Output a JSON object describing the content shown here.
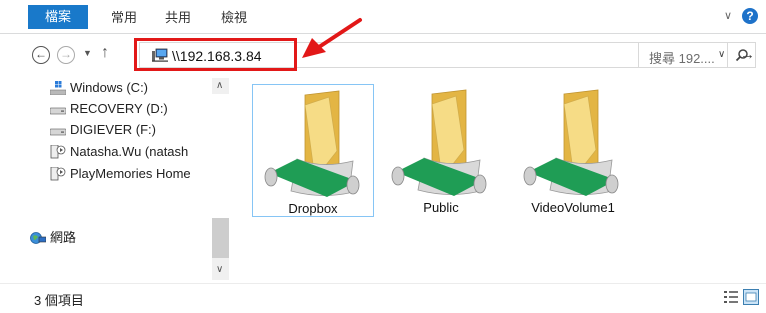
{
  "ribbon": {
    "tabs": [
      "檔案",
      "常用",
      "共用",
      "檢視"
    ],
    "help_label": "?"
  },
  "address": {
    "path": "\\\\192.168.3.84"
  },
  "search": {
    "placeholder": "搜尋 192...."
  },
  "nav_pane": {
    "items": [
      {
        "label": "Windows (C:)",
        "icon": "windows-drive-icon"
      },
      {
        "label": "RECOVERY (D:)",
        "icon": "drive-icon"
      },
      {
        "label": "DIGIEVER (F:)",
        "icon": "drive-icon"
      },
      {
        "label": "Natasha.Wu (natash",
        "icon": "media-server-icon"
      },
      {
        "label": "PlayMemories Home",
        "icon": "media-server-icon"
      }
    ],
    "network_label": "網路"
  },
  "folders": [
    {
      "label": "Dropbox",
      "selected": true
    },
    {
      "label": "Public",
      "selected": false
    },
    {
      "label": "VideoVolume1",
      "selected": false
    }
  ],
  "status": {
    "item_count": "3 個項目"
  },
  "colors": {
    "accent": "#1979ca",
    "highlight": "#e21818",
    "selection_border": "#86c5f5",
    "folder_yellow": "#f1cd62",
    "share_green": "#1f9d55"
  }
}
